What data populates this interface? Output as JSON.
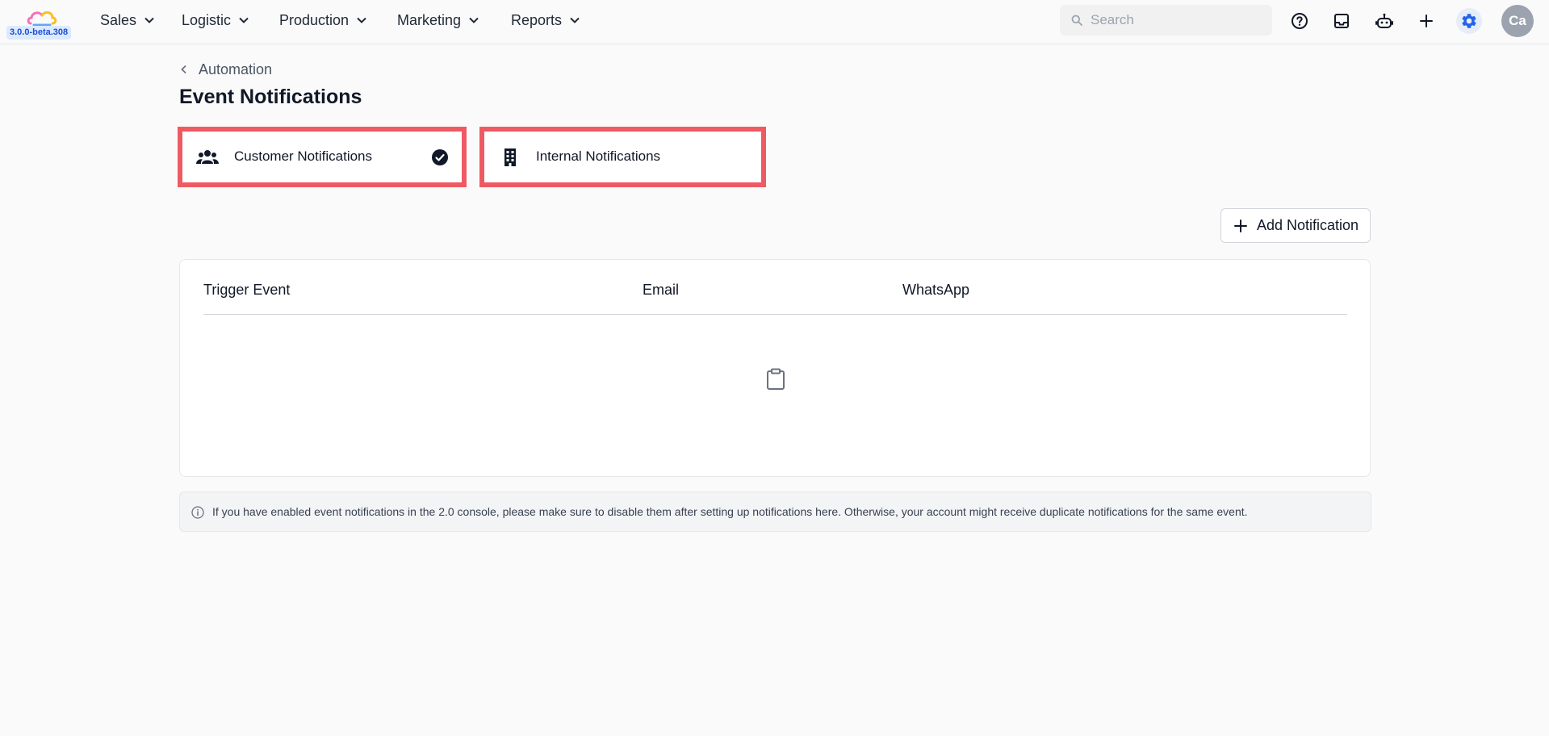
{
  "app": {
    "version": "3.0.0-beta.308",
    "logo_colors": [
      "#f472b6",
      "#fbbf24",
      "#60a5fa"
    ]
  },
  "nav": [
    {
      "label": "Sales",
      "icon": "chevron-down-icon"
    },
    {
      "label": "Logistic",
      "icon": "chevron-down-icon"
    },
    {
      "label": "Production",
      "icon": "chevron-down-icon"
    },
    {
      "label": "Marketing",
      "icon": "chevron-down-icon"
    },
    {
      "label": "Reports",
      "icon": "chevron-down-icon"
    }
  ],
  "search": {
    "placeholder": "Search",
    "value": ""
  },
  "toolbar_icons": [
    "help-icon",
    "inbox-icon",
    "bot-icon",
    "plus-icon",
    "gear-icon"
  ],
  "user": {
    "initials": "Ca"
  },
  "breadcrumb": {
    "label": "Automation"
  },
  "page": {
    "title": "Event Notifications"
  },
  "tabs": [
    {
      "label": "Customer Notifications",
      "icon": "users-icon",
      "selected": true
    },
    {
      "label": "Internal Notifications",
      "icon": "building-icon",
      "selected": false
    }
  ],
  "actions": {
    "add_notification": "Add Notification"
  },
  "table": {
    "columns": [
      "Trigger Event",
      "Email",
      "WhatsApp"
    ],
    "rows": [],
    "empty_icon": "clipboard-icon"
  },
  "info": {
    "text": "If you have enabled event notifications in the 2.0 console, please make sure to disable them after setting up notifications here. Otherwise, your account might receive duplicate notifications for the same event."
  },
  "colors": {
    "highlight_border": "#ef5a62",
    "accent": "#2563eb",
    "version_badge_bg": "#dbeafe"
  }
}
